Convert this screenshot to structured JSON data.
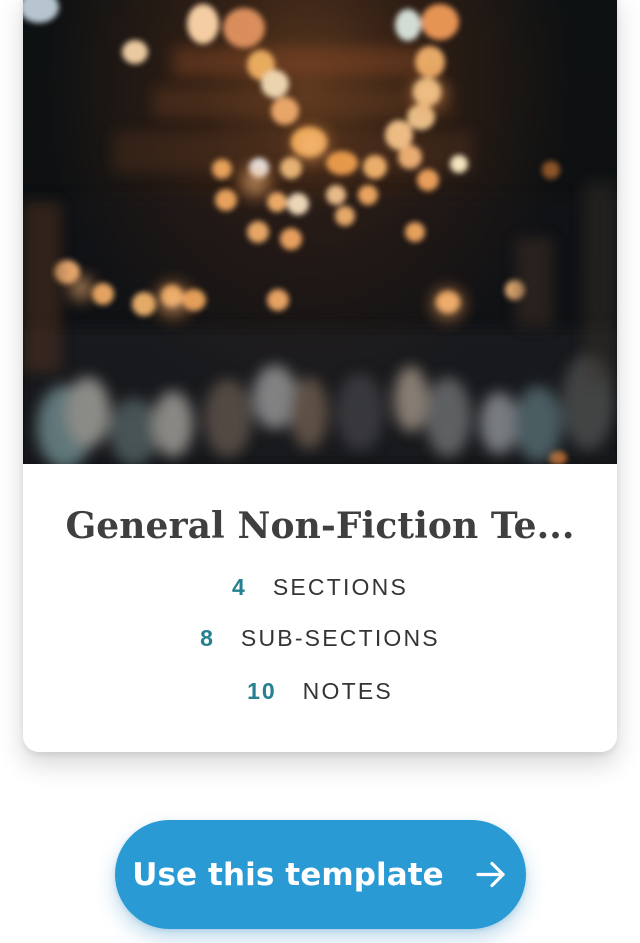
{
  "card": {
    "title": "General Non-Fiction Te...",
    "stats": {
      "sections": {
        "number": "4",
        "label": "SECTIONS"
      },
      "subsections": {
        "number": "8",
        "label": "SUB-SECTIONS"
      },
      "notes": {
        "number": "10",
        "label": "NOTES"
      }
    },
    "image": {
      "icon": "bokeh-photo-icon"
    }
  },
  "button": {
    "label": "Use this template",
    "icon": "arrow-right-icon"
  },
  "colors": {
    "accent": "#2a9ad4",
    "stat_number": "#25808f",
    "title": "#3f3f3f",
    "label": "#343434"
  }
}
